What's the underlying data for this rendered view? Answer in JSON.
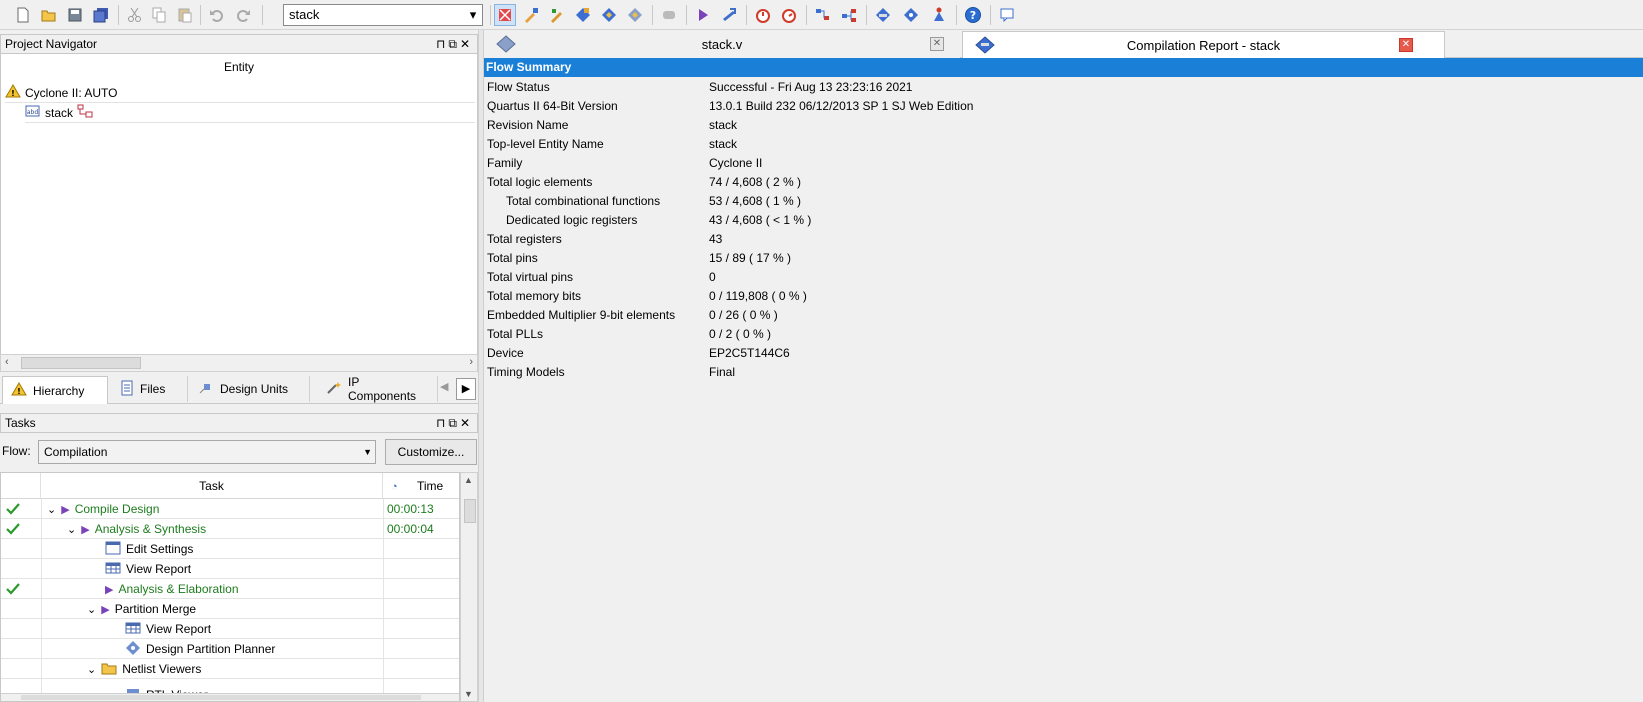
{
  "toolbar": {
    "project_combo": "stack",
    "icons": [
      "new-file-icon",
      "open-file-icon",
      "save-icon",
      "save-all-icon",
      "cut-icon",
      "copy-icon",
      "paste-icon",
      "undo-icon",
      "redo-icon",
      "compile-icon",
      "assignment-editor-icon",
      "pin-planner-icon",
      "chip-planner-icon",
      "settings-icon",
      "netlist-icon",
      "stop-icon",
      "start-compilation-icon",
      "analysis-icon",
      "timing-icon",
      "timequest-icon",
      "rtl-viewer-icon",
      "tech-map-icon",
      "programmer-icon",
      "signaltap-icon",
      "sopc-icon",
      "help-icon",
      "chat-icon"
    ]
  },
  "navigator": {
    "title": "Project Navigator",
    "column_header": "Entity",
    "device_row": "Cyclone II: AUTO",
    "entity_row": "stack",
    "tabs": [
      "Hierarchy",
      "Files",
      "Design Units",
      "IP Components"
    ]
  },
  "tasks": {
    "title": "Tasks",
    "flow_label": "Flow:",
    "flow_value": "Compilation",
    "customize_label": "Customize...",
    "col_task": "Task",
    "col_time": "Time",
    "rows": [
      {
        "label": "Compile Design",
        "time": "00:00:13"
      },
      {
        "label": "Analysis & Synthesis",
        "time": "00:00:04"
      },
      {
        "label": "Edit Settings",
        "time": ""
      },
      {
        "label": "View Report",
        "time": ""
      },
      {
        "label": "Analysis & Elaboration",
        "time": ""
      },
      {
        "label": "Partition Merge",
        "time": ""
      },
      {
        "label": "View Report",
        "time": ""
      },
      {
        "label": "Design Partition Planner",
        "time": ""
      },
      {
        "label": "Netlist Viewers",
        "time": ""
      },
      {
        "label": "RTL Viewer",
        "time": ""
      }
    ]
  },
  "doc_tabs": {
    "tab1": "stack.v",
    "tab2": "Compilation Report - stack"
  },
  "report": {
    "header": "Flow Summary",
    "rows": [
      {
        "k": "Flow Status",
        "v": "Successful - Fri Aug 13 23:23:16 2021"
      },
      {
        "k": "Quartus II 64-Bit Version",
        "v": "13.0.1 Build 232 06/12/2013 SP 1 SJ Web Edition"
      },
      {
        "k": "Revision Name",
        "v": "stack"
      },
      {
        "k": "Top-level Entity Name",
        "v": "stack"
      },
      {
        "k": "Family",
        "v": "Cyclone II"
      },
      {
        "k": "Total logic elements",
        "v": "74 / 4,608 ( 2 % )"
      },
      {
        "k": "Total combinational functions",
        "v": "53 / 4,608 ( 1 % )"
      },
      {
        "k": "Dedicated logic registers",
        "v": "43 / 4,608 ( < 1 % )"
      },
      {
        "k": "Total registers",
        "v": "43"
      },
      {
        "k": "Total pins",
        "v": "15 / 89 ( 17 % )"
      },
      {
        "k": "Total virtual pins",
        "v": "0"
      },
      {
        "k": "Total memory bits",
        "v": "0 / 119,808 ( 0 % )"
      },
      {
        "k": "Embedded Multiplier 9-bit elements",
        "v": "0 / 26 ( 0 % )"
      },
      {
        "k": "Total PLLs",
        "v": "0 / 2 ( 0 % )"
      },
      {
        "k": "Device",
        "v": "EP2C5T144C6"
      },
      {
        "k": "Timing Models",
        "v": "Final"
      }
    ]
  },
  "colors": {
    "accent_blue": "#1a7fd6",
    "success_green": "#1e7c1e",
    "close_red": "#e55a4a"
  }
}
